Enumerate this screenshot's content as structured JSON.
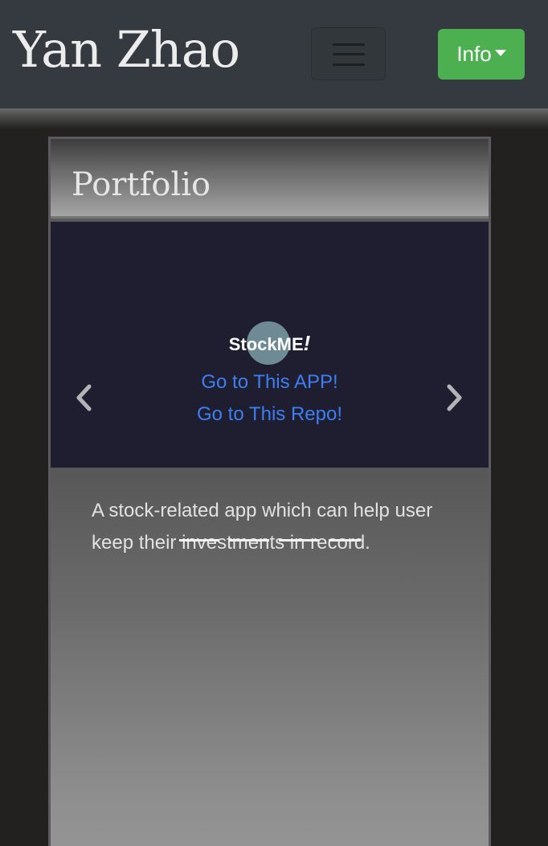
{
  "navbar": {
    "brand": "Yan Zhao",
    "toggler_icon": "hamburger-icon",
    "info_label": "Info",
    "info_color": "#4caf50"
  },
  "portfolio": {
    "title": "Portfolio",
    "carousel": {
      "logo_text": "StockME",
      "logo_mark": "!",
      "app_link": "Go to This APP!",
      "repo_link": "Go to This Repo!",
      "link_color": "#3d7ef0",
      "prev_icon": "chevron-left-icon",
      "next_icon": "chevron-right-icon"
    },
    "description": "A stock-related app which can help user keep their investments in record."
  }
}
